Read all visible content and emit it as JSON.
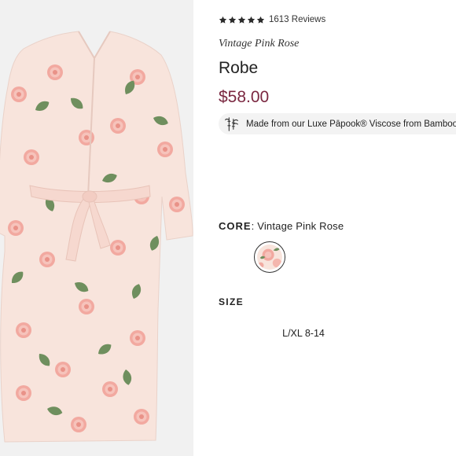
{
  "product": {
    "rating": {
      "stars": 5,
      "star_icon": "star-icon",
      "reviews_label": "1613 Reviews"
    },
    "collection": "Vintage Pink Rose",
    "title": "Robe",
    "price": "$58.00",
    "fabric_note": {
      "icon": "bamboo-icon",
      "text": "Made from our Luxe Pāpook® Viscose from Bamboo"
    },
    "core": {
      "label": "CORE",
      "separator": ":",
      "value": "Vintage Pink Rose",
      "swatch_icon": "floral-swatch"
    },
    "size": {
      "label": "SIZE",
      "options": [
        "L/XL 8-14"
      ]
    }
  },
  "colors": {
    "price": "#7a2740",
    "robe_base": "#f8e4dc",
    "rose": "#f0a8a0",
    "leaf": "#6f8f5e",
    "image_background": "#f1f1f1"
  }
}
